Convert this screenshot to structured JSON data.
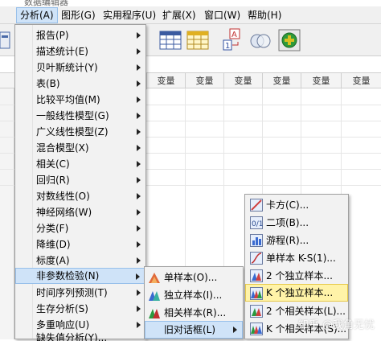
{
  "window": {
    "title": "数据编辑器"
  },
  "menubar": [
    {
      "label": "分析(A)"
    },
    {
      "label": "图形(G)"
    },
    {
      "label": "实用程序(U)"
    },
    {
      "label": "扩展(X)"
    },
    {
      "label": "窗口(W)"
    },
    {
      "label": "帮助(H)"
    }
  ],
  "grid": {
    "column_header": "变量"
  },
  "analyze_menu": [
    {
      "label": "报告(P)"
    },
    {
      "label": "描述统计(E)"
    },
    {
      "label": "贝叶斯统计(Y)"
    },
    {
      "label": "表(B)"
    },
    {
      "label": "比较平均值(M)"
    },
    {
      "label": "一般线性模型(G)"
    },
    {
      "label": "广义线性模型(Z)"
    },
    {
      "label": "混合模型(X)"
    },
    {
      "label": "相关(C)"
    },
    {
      "label": "回归(R)"
    },
    {
      "label": "对数线性(O)"
    },
    {
      "label": "神经网络(W)"
    },
    {
      "label": "分类(F)"
    },
    {
      "label": "降维(D)"
    },
    {
      "label": "标度(A)"
    },
    {
      "label": "非参数检验(N)"
    },
    {
      "label": "时间序列预测(T)"
    },
    {
      "label": "生存分析(S)"
    },
    {
      "label": "多重响应(U)"
    },
    {
      "label": "缺失值分析(Y)..."
    }
  ],
  "nonparametric_menu": [
    {
      "label": "单样本(O)..."
    },
    {
      "label": "独立样本(I)..."
    },
    {
      "label": "相关样本(R)..."
    },
    {
      "label": "旧对话框(L)"
    }
  ],
  "legacy_dialogs_menu": [
    {
      "label": "卡方(C)..."
    },
    {
      "label": "二项(B)..."
    },
    {
      "label": "游程(R)..."
    },
    {
      "label": "单样本 K-S(1)..."
    },
    {
      "label": "2 个独立样本..."
    },
    {
      "label": "K 个独立样本..."
    },
    {
      "label": "2 个相关样本(L)..."
    },
    {
      "label": "K 个相关样本(S)..."
    }
  ],
  "watermark": "知乎 @我角无忧",
  "colors": {
    "menu_highlight": "#cfe3f8",
    "submenu_highlight": "#fff3a8",
    "menu_bg": "#f2f2f2"
  }
}
